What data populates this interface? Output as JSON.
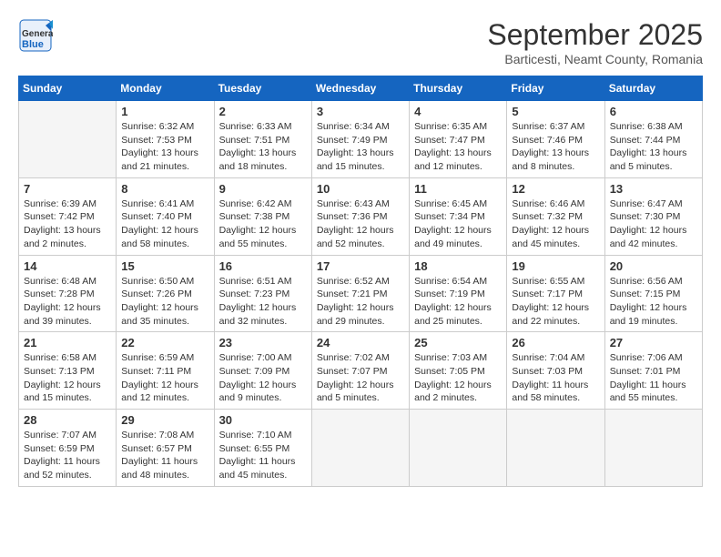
{
  "header": {
    "logo_general": "General",
    "logo_blue": "Blue",
    "month": "September 2025",
    "location": "Barticesti, Neamt County, Romania"
  },
  "days_of_week": [
    "Sunday",
    "Monday",
    "Tuesday",
    "Wednesday",
    "Thursday",
    "Friday",
    "Saturday"
  ],
  "weeks": [
    [
      {
        "day": "",
        "info": ""
      },
      {
        "day": "1",
        "info": "Sunrise: 6:32 AM\nSunset: 7:53 PM\nDaylight: 13 hours\nand 21 minutes."
      },
      {
        "day": "2",
        "info": "Sunrise: 6:33 AM\nSunset: 7:51 PM\nDaylight: 13 hours\nand 18 minutes."
      },
      {
        "day": "3",
        "info": "Sunrise: 6:34 AM\nSunset: 7:49 PM\nDaylight: 13 hours\nand 15 minutes."
      },
      {
        "day": "4",
        "info": "Sunrise: 6:35 AM\nSunset: 7:47 PM\nDaylight: 13 hours\nand 12 minutes."
      },
      {
        "day": "5",
        "info": "Sunrise: 6:37 AM\nSunset: 7:46 PM\nDaylight: 13 hours\nand 8 minutes."
      },
      {
        "day": "6",
        "info": "Sunrise: 6:38 AM\nSunset: 7:44 PM\nDaylight: 13 hours\nand 5 minutes."
      }
    ],
    [
      {
        "day": "7",
        "info": "Sunrise: 6:39 AM\nSunset: 7:42 PM\nDaylight: 13 hours\nand 2 minutes."
      },
      {
        "day": "8",
        "info": "Sunrise: 6:41 AM\nSunset: 7:40 PM\nDaylight: 12 hours\nand 58 minutes."
      },
      {
        "day": "9",
        "info": "Sunrise: 6:42 AM\nSunset: 7:38 PM\nDaylight: 12 hours\nand 55 minutes."
      },
      {
        "day": "10",
        "info": "Sunrise: 6:43 AM\nSunset: 7:36 PM\nDaylight: 12 hours\nand 52 minutes."
      },
      {
        "day": "11",
        "info": "Sunrise: 6:45 AM\nSunset: 7:34 PM\nDaylight: 12 hours\nand 49 minutes."
      },
      {
        "day": "12",
        "info": "Sunrise: 6:46 AM\nSunset: 7:32 PM\nDaylight: 12 hours\nand 45 minutes."
      },
      {
        "day": "13",
        "info": "Sunrise: 6:47 AM\nSunset: 7:30 PM\nDaylight: 12 hours\nand 42 minutes."
      }
    ],
    [
      {
        "day": "14",
        "info": "Sunrise: 6:48 AM\nSunset: 7:28 PM\nDaylight: 12 hours\nand 39 minutes."
      },
      {
        "day": "15",
        "info": "Sunrise: 6:50 AM\nSunset: 7:26 PM\nDaylight: 12 hours\nand 35 minutes."
      },
      {
        "day": "16",
        "info": "Sunrise: 6:51 AM\nSunset: 7:23 PM\nDaylight: 12 hours\nand 32 minutes."
      },
      {
        "day": "17",
        "info": "Sunrise: 6:52 AM\nSunset: 7:21 PM\nDaylight: 12 hours\nand 29 minutes."
      },
      {
        "day": "18",
        "info": "Sunrise: 6:54 AM\nSunset: 7:19 PM\nDaylight: 12 hours\nand 25 minutes."
      },
      {
        "day": "19",
        "info": "Sunrise: 6:55 AM\nSunset: 7:17 PM\nDaylight: 12 hours\nand 22 minutes."
      },
      {
        "day": "20",
        "info": "Sunrise: 6:56 AM\nSunset: 7:15 PM\nDaylight: 12 hours\nand 19 minutes."
      }
    ],
    [
      {
        "day": "21",
        "info": "Sunrise: 6:58 AM\nSunset: 7:13 PM\nDaylight: 12 hours\nand 15 minutes."
      },
      {
        "day": "22",
        "info": "Sunrise: 6:59 AM\nSunset: 7:11 PM\nDaylight: 12 hours\nand 12 minutes."
      },
      {
        "day": "23",
        "info": "Sunrise: 7:00 AM\nSunset: 7:09 PM\nDaylight: 12 hours\nand 9 minutes."
      },
      {
        "day": "24",
        "info": "Sunrise: 7:02 AM\nSunset: 7:07 PM\nDaylight: 12 hours\nand 5 minutes."
      },
      {
        "day": "25",
        "info": "Sunrise: 7:03 AM\nSunset: 7:05 PM\nDaylight: 12 hours\nand 2 minutes."
      },
      {
        "day": "26",
        "info": "Sunrise: 7:04 AM\nSunset: 7:03 PM\nDaylight: 11 hours\nand 58 minutes."
      },
      {
        "day": "27",
        "info": "Sunrise: 7:06 AM\nSunset: 7:01 PM\nDaylight: 11 hours\nand 55 minutes."
      }
    ],
    [
      {
        "day": "28",
        "info": "Sunrise: 7:07 AM\nSunset: 6:59 PM\nDaylight: 11 hours\nand 52 minutes."
      },
      {
        "day": "29",
        "info": "Sunrise: 7:08 AM\nSunset: 6:57 PM\nDaylight: 11 hours\nand 48 minutes."
      },
      {
        "day": "30",
        "info": "Sunrise: 7:10 AM\nSunset: 6:55 PM\nDaylight: 11 hours\nand 45 minutes."
      },
      {
        "day": "",
        "info": ""
      },
      {
        "day": "",
        "info": ""
      },
      {
        "day": "",
        "info": ""
      },
      {
        "day": "",
        "info": ""
      }
    ]
  ]
}
